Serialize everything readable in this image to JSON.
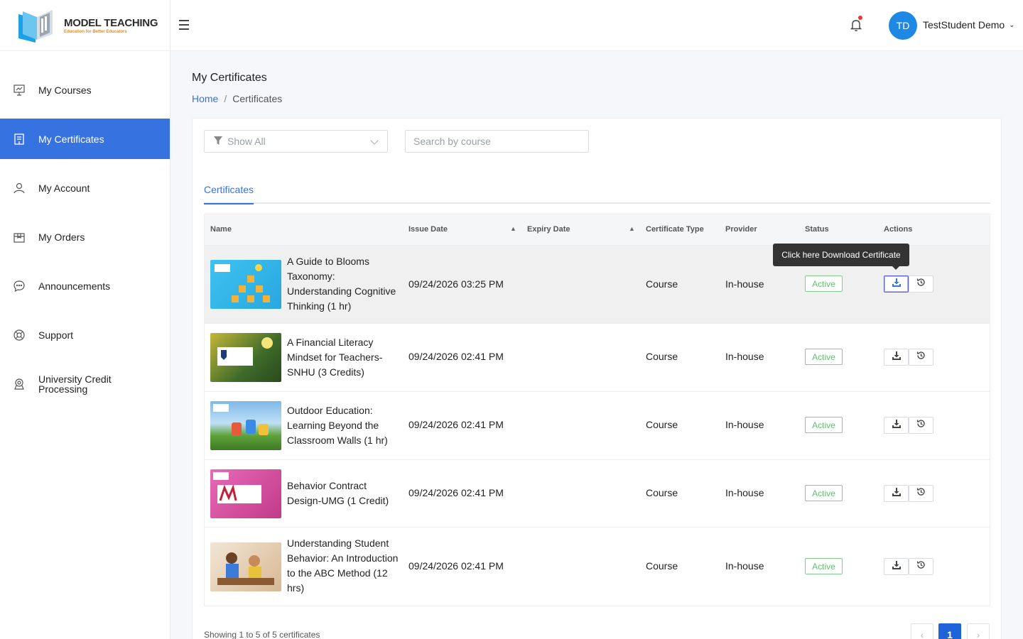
{
  "brand": {
    "title": "MODEL TEACHING",
    "tagline": "Education for Better Educators"
  },
  "sidebar": {
    "items": [
      {
        "label": "My Courses",
        "icon": "presentation-icon"
      },
      {
        "label": "My Certificates",
        "icon": "certificate-icon",
        "active": true
      },
      {
        "label": "My Account",
        "icon": "user-icon"
      },
      {
        "label": "My Orders",
        "icon": "box-icon"
      },
      {
        "label": "Announcements",
        "icon": "chat-bubble-icon"
      },
      {
        "label": "Support",
        "icon": "lifebuoy-icon"
      },
      {
        "label": "University Credit Processing",
        "icon": "location-badge-icon"
      }
    ]
  },
  "header": {
    "avatar_initials": "TD",
    "user_name": "TestStudent Demo",
    "accent": "#3773e0"
  },
  "page": {
    "title": "My Certificates",
    "breadcrumb_home": "Home",
    "breadcrumb_sep": "/",
    "breadcrumb_current": "Certificates"
  },
  "filters": {
    "select_value": "Show All",
    "search_placeholder": "Search by course"
  },
  "tabs": {
    "active": "Certificates"
  },
  "table": {
    "columns": [
      "Name",
      "Issue Date",
      "Expiry Date",
      "Certificate Type",
      "Provider",
      "Status",
      "Actions"
    ],
    "tooltip": "Click here Download Certificate",
    "rows": [
      {
        "name": "A Guide to Blooms Taxonomy: Understanding Cognitive Thinking (1 hr)",
        "issue_date": "09/24/2026 03:25 PM",
        "expiry_date": "",
        "type": "Course",
        "provider": "In-house",
        "status": "Active"
      },
      {
        "name": "A Financial Literacy Mindset for Teachers- SNHU (3 Credits)",
        "issue_date": "09/24/2026 02:41 PM",
        "expiry_date": "",
        "type": "Course",
        "provider": "In-house",
        "status": "Active"
      },
      {
        "name": "Outdoor Education: Learning Beyond the Classroom Walls (1 hr)",
        "issue_date": "09/24/2026 02:41 PM",
        "expiry_date": "",
        "type": "Course",
        "provider": "In-house",
        "status": "Active"
      },
      {
        "name": "Behavior Contract Design-UMG (1 Credit)",
        "issue_date": "09/24/2026 02:41 PM",
        "expiry_date": "",
        "type": "Course",
        "provider": "In-house",
        "status": "Active"
      },
      {
        "name": "Understanding Student Behavior: An Introduction to the ABC Method (12 hrs)",
        "issue_date": "09/24/2026 02:41 PM",
        "expiry_date": "",
        "type": "Course",
        "provider": "In-house",
        "status": "Active"
      }
    ]
  },
  "pagination": {
    "info": "Showing 1 to 5 of 5 certificates",
    "prev": "‹",
    "current": "1",
    "next": "›"
  }
}
